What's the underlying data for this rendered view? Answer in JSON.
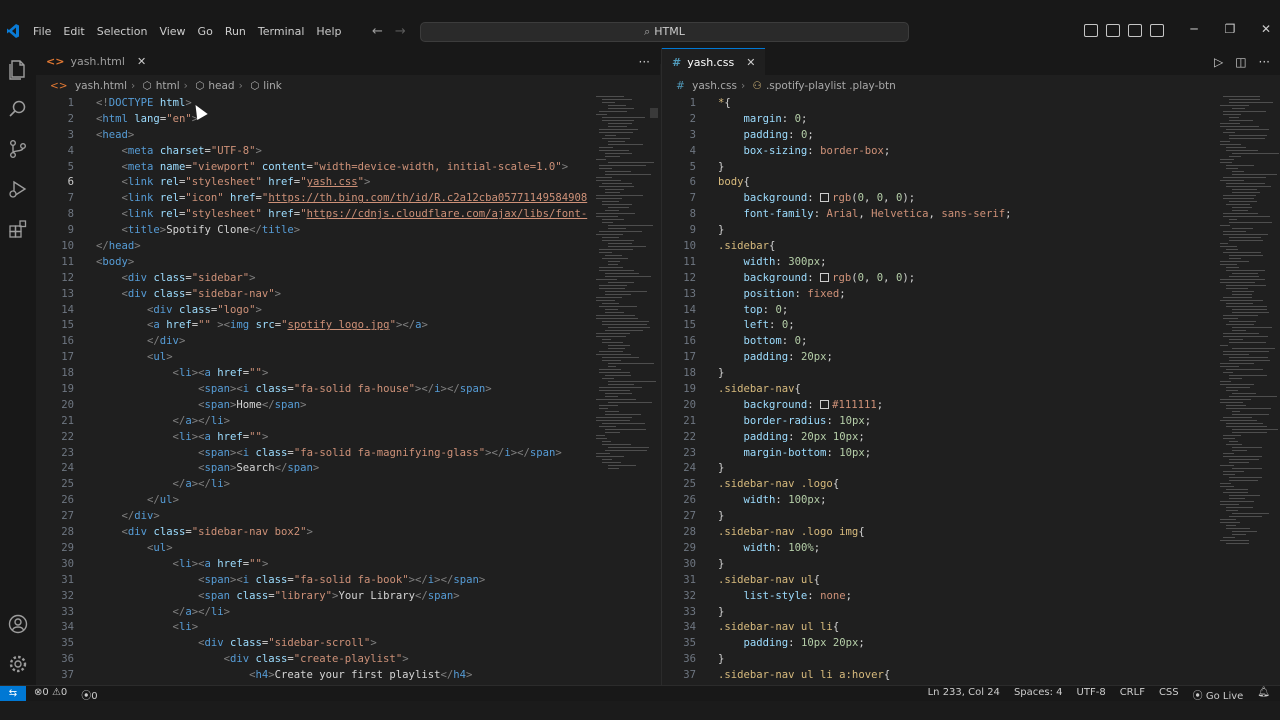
{
  "menu": [
    "File",
    "Edit",
    "Selection",
    "View",
    "Go",
    "Run",
    "Terminal",
    "Help"
  ],
  "search": {
    "label": "HTML"
  },
  "left": {
    "tab": {
      "name": "yash.html",
      "icon": "<>"
    },
    "breadcrumb": [
      "yash.html",
      "html",
      "head",
      "link"
    ],
    "lines": [
      {
        "n": "1",
        "code": "<!DOCTYPE html>"
      },
      {
        "n": "2",
        "code": "<html lang=\"en\">"
      },
      {
        "n": "3",
        "code": "<head>"
      },
      {
        "n": "4",
        "code": "    <meta charset=\"UTF-8\">"
      },
      {
        "n": "5",
        "code": "    <meta name=\"viewport\" content=\"width=device-width, initial-scale=1.0\">"
      },
      {
        "n": "6",
        "code": "    <link rel=\"stylesheet\" href=\"yash.css\">"
      },
      {
        "n": "7",
        "code": "    <link rel=\"icon\" href=\"https://th.bing.com/th/id/R.c2a12cba05771149584908"
      },
      {
        "n": "8",
        "code": "    <link rel=\"stylesheet\" href=\"https://cdnjs.cloudflare.com/ajax/libs/font-"
      },
      {
        "n": "9",
        "code": "    <title>Spotify Clone</title>"
      },
      {
        "n": "10",
        "code": "</head>"
      },
      {
        "n": "11",
        "code": "<body>"
      },
      {
        "n": "12",
        "code": "    <div class=\"sidebar\">"
      },
      {
        "n": "13",
        "code": "    <div class=\"sidebar-nav\">"
      },
      {
        "n": "14",
        "code": "        <div class=\"logo\">"
      },
      {
        "n": "15",
        "code": "        <a href=\"\" ><img src=\"spotify logo.jpg\"></a>"
      },
      {
        "n": "16",
        "code": "        </div>"
      },
      {
        "n": "17",
        "code": "        <ul>"
      },
      {
        "n": "18",
        "code": "            <li><a href=\"\">"
      },
      {
        "n": "19",
        "code": "                <span><i class=\"fa-solid fa-house\"></i></span>"
      },
      {
        "n": "20",
        "code": "                <span>Home</span>"
      },
      {
        "n": "21",
        "code": "            </a></li>"
      },
      {
        "n": "22",
        "code": "            <li><a href=\"\">"
      },
      {
        "n": "23",
        "code": "                <span><i class=\"fa-solid fa-magnifying-glass\"></i></span>"
      },
      {
        "n": "24",
        "code": "                <span>Search</span>"
      },
      {
        "n": "25",
        "code": "            </a></li>"
      },
      {
        "n": "26",
        "code": "        </ul>"
      },
      {
        "n": "27",
        "code": "    </div>"
      },
      {
        "n": "28",
        "code": "    <div class=\"sidebar-nav box2\">"
      },
      {
        "n": "29",
        "code": "        <ul>"
      },
      {
        "n": "30",
        "code": "            <li><a href=\"\">"
      },
      {
        "n": "31",
        "code": "                <span><i class=\"fa-solid fa-book\"></i></span>"
      },
      {
        "n": "32",
        "code": "                <span class=\"library\">Your Library</span>"
      },
      {
        "n": "33",
        "code": "            </a></li>"
      },
      {
        "n": "34",
        "code": "            <li>"
      },
      {
        "n": "35",
        "code": "                <div class=\"sidebar-scroll\">"
      },
      {
        "n": "36",
        "code": "                    <div class=\"create-playlist\">"
      },
      {
        "n": "37",
        "code": "                        <h4>Create your first playlist</h4>"
      }
    ]
  },
  "right": {
    "tab": {
      "name": "yash.css",
      "icon": "#"
    },
    "breadcrumb": [
      "yash.css",
      ".spotify-playlist .play-btn"
    ],
    "lines": [
      {
        "n": "1",
        "code": "*{"
      },
      {
        "n": "2",
        "code": "    margin: 0;"
      },
      {
        "n": "3",
        "code": "    padding: 0;"
      },
      {
        "n": "4",
        "code": "    box-sizing: border-box;"
      },
      {
        "n": "5",
        "code": "}"
      },
      {
        "n": "6",
        "code": "body{"
      },
      {
        "n": "7",
        "code": "    background: rgb(0, 0, 0);"
      },
      {
        "n": "8",
        "code": "    font-family: Arial, Helvetica, sans-serif;"
      },
      {
        "n": "9",
        "code": "}"
      },
      {
        "n": "10",
        "code": ".sidebar{"
      },
      {
        "n": "11",
        "code": "    width: 300px;"
      },
      {
        "n": "12",
        "code": "    background: rgb(0, 0, 0);"
      },
      {
        "n": "13",
        "code": "    position: fixed;"
      },
      {
        "n": "14",
        "code": "    top: 0;"
      },
      {
        "n": "15",
        "code": "    left: 0;"
      },
      {
        "n": "16",
        "code": "    bottom: 0;"
      },
      {
        "n": "17",
        "code": "    padding: 20px;"
      },
      {
        "n": "18",
        "code": "}"
      },
      {
        "n": "19",
        "code": ".sidebar-nav{"
      },
      {
        "n": "20",
        "code": "    background: #111111;"
      },
      {
        "n": "21",
        "code": "    border-radius: 10px;"
      },
      {
        "n": "22",
        "code": "    padding: 20px 10px;"
      },
      {
        "n": "23",
        "code": "    margin-bottom: 10px;"
      },
      {
        "n": "24",
        "code": "}"
      },
      {
        "n": "25",
        "code": ".sidebar-nav .logo{"
      },
      {
        "n": "26",
        "code": "    width: 100px;"
      },
      {
        "n": "27",
        "code": "}"
      },
      {
        "n": "28",
        "code": ".sidebar-nav .logo img{"
      },
      {
        "n": "29",
        "code": "    width: 100%;"
      },
      {
        "n": "30",
        "code": "}"
      },
      {
        "n": "31",
        "code": ".sidebar-nav ul{"
      },
      {
        "n": "32",
        "code": "    list-style: none;"
      },
      {
        "n": "33",
        "code": "}"
      },
      {
        "n": "34",
        "code": ".sidebar-nav ul li{"
      },
      {
        "n": "35",
        "code": "    padding: 10px 20px;"
      },
      {
        "n": "36",
        "code": "}"
      },
      {
        "n": "37",
        "code": ".sidebar-nav ul li a:hover{"
      }
    ]
  },
  "status": {
    "errors": "0",
    "warnings": "0",
    "ports": "0",
    "position": "Ln 233, Col 24",
    "spaces": "Spaces: 4",
    "encoding": "UTF-8",
    "eol": "CRLF",
    "language": "CSS",
    "golive": "Go Live"
  },
  "colors": {
    "accent": "#0078d4",
    "tag": "#569cd6",
    "attr": "#9cdcfe",
    "string": "#ce9178",
    "selector": "#d7ba7d"
  }
}
